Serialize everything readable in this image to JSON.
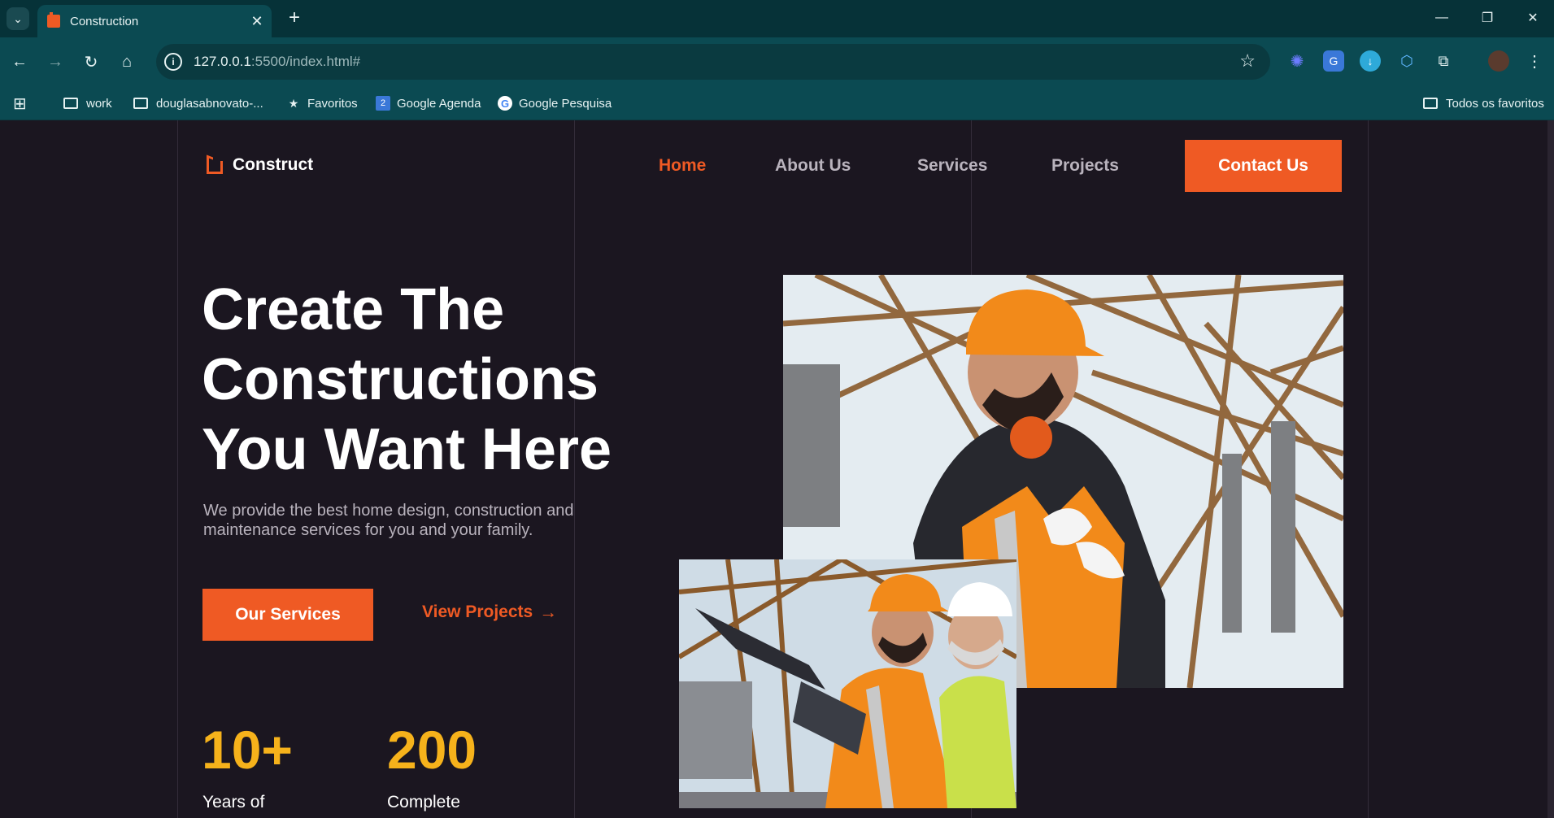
{
  "browser": {
    "tab_title": "Construction",
    "url_host": "127.0.0.1",
    "url_rest": ":5500/index.html#",
    "bookmarks": [
      {
        "label": "work",
        "icon": "folder-icon"
      },
      {
        "label": "douglasabnovato-...",
        "icon": "folder-icon"
      },
      {
        "label": "Favoritos",
        "icon": "star-icon"
      },
      {
        "label": "Google Agenda",
        "icon": "calendar-icon"
      },
      {
        "label": "Google Pesquisa",
        "icon": "google-icon"
      }
    ],
    "all_bookmarks": "Todos os favoritos"
  },
  "site": {
    "logo": "Construct",
    "nav": [
      "Home",
      "About Us",
      "Services",
      "Projects"
    ],
    "contact": "Contact Us",
    "hero_title_lines": [
      "Create The",
      "Constructions",
      "You Want Here"
    ],
    "hero_subtitle": "We provide the best home design, construction and maintenance services for you and your family.",
    "primary_button": "Our Services",
    "secondary_button": "View Projects",
    "stats": [
      {
        "value": "10+",
        "label": "Years of"
      },
      {
        "value": "200",
        "label": "Complete"
      }
    ]
  },
  "colors": {
    "accent": "#ef5a24",
    "stat": "#f6b21b",
    "page_bg": "#1b1620",
    "browser_bg": "#0b4a52"
  }
}
